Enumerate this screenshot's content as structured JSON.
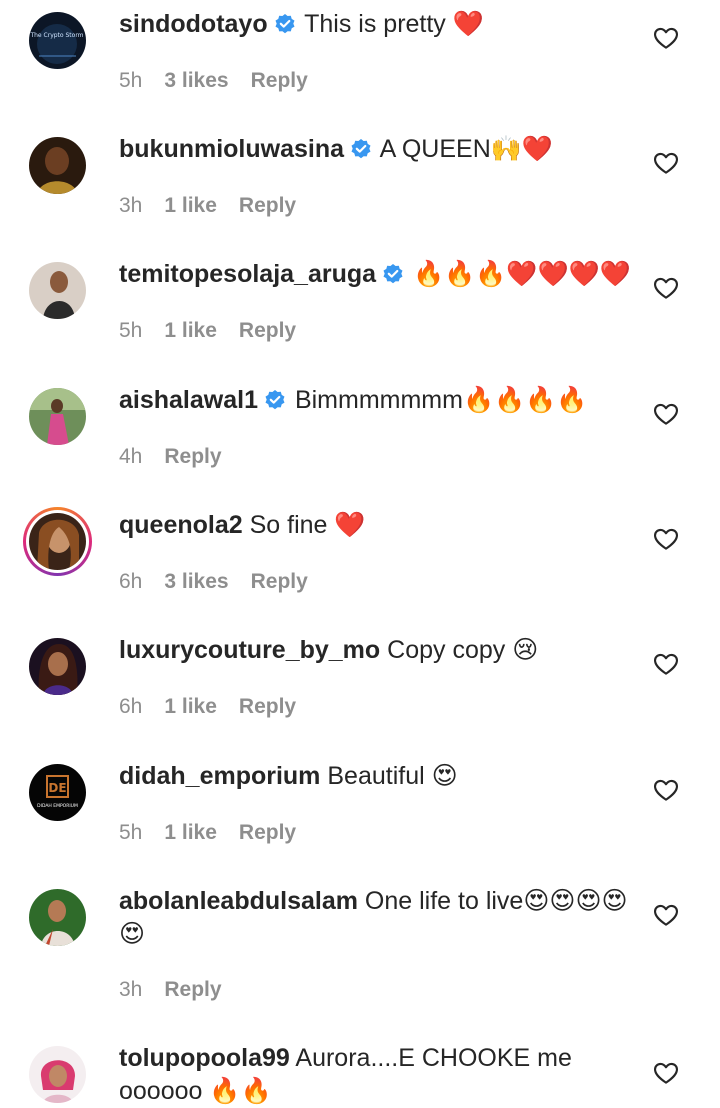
{
  "comments": [
    {
      "username": "sindodotayo",
      "verified": true,
      "text": "This is pretty ❤️",
      "time": "5h",
      "likes": "3 likes",
      "reply": "Reply",
      "avatar_logo_text": "The Crypto Storm"
    },
    {
      "username": "bukunmioluwasina",
      "verified": true,
      "text": "A QUEEN🙌❤️",
      "time": "3h",
      "likes": "1 like",
      "reply": "Reply"
    },
    {
      "username": "temitopesolaja_aruga",
      "verified": true,
      "text": "🔥🔥🔥❤️❤️❤️❤️",
      "time": "5h",
      "likes": "1 like",
      "reply": "Reply"
    },
    {
      "username": "aishalawal1",
      "verified": true,
      "text": "Bimmmmmmm🔥🔥🔥🔥",
      "time": "4h",
      "likes": "",
      "reply": "Reply"
    },
    {
      "username": "queenola2",
      "verified": false,
      "text": "So fine ❤️",
      "time": "6h",
      "likes": "3 likes",
      "reply": "Reply",
      "has_story": true
    },
    {
      "username": "luxurycouture_by_mo",
      "verified": false,
      "text": "Copy copy 😢",
      "time": "6h",
      "likes": "1 like",
      "reply": "Reply"
    },
    {
      "username": "didah_emporium",
      "verified": false,
      "text": "Beautiful 😍",
      "time": "5h",
      "likes": "1 like",
      "reply": "Reply",
      "avatar_logo_text": "DIDAH EMPORIUM"
    },
    {
      "username": "abolanleabdulsalam",
      "verified": false,
      "text": "One life to live😍😍😍😍😍",
      "time": "3h",
      "likes": "",
      "reply": "Reply"
    },
    {
      "username": "tolupopoola99",
      "verified": false,
      "text": "Aurora....E CHOOKE me oooooo 🔥🔥",
      "time": "",
      "likes": "",
      "reply": ""
    }
  ],
  "icons": {
    "verified": "verified-badge-icon",
    "like": "heart-outline-icon"
  },
  "colors": {
    "text": "#262626",
    "meta": "#8e8e8e",
    "verified": "#3897f0",
    "background": "#ffffff"
  }
}
